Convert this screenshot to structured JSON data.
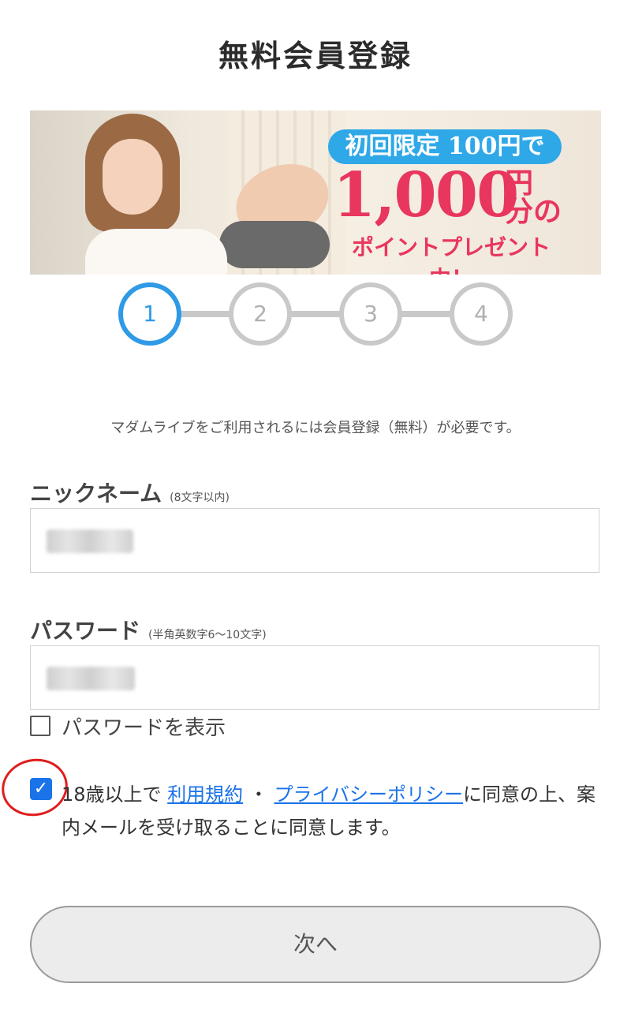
{
  "page": {
    "title": "無料会員登録"
  },
  "banner": {
    "pill_text": "初回限定 100円で",
    "amount": "1,000",
    "unit_line1": "円",
    "unit_line2": "分の",
    "promo_text": "ポイントプレゼント中！"
  },
  "steps": {
    "items": [
      "1",
      "2",
      "3",
      "4"
    ],
    "active": 1
  },
  "intro": "マダムライブをご利用されるには会員登録（無料）が必要です。",
  "nickname": {
    "label": "ニックネーム",
    "hint": "(8文字以内)"
  },
  "password": {
    "label": "パスワード",
    "hint": "(半角英数字6〜10文字)"
  },
  "show_password": {
    "label": "パスワードを表示",
    "checked": false
  },
  "agreement": {
    "checked": true,
    "prefix": "18歳以上で",
    "terms_link": "利用規約",
    "separator": "・",
    "privacy_link": "プライバシーポリシー",
    "suffix": "に同意の上、案内メールを受け取ることに同意します。"
  },
  "next_button": {
    "label": "次へ"
  },
  "colors": {
    "accent": "#2f9ae5",
    "promo": "#e8365e",
    "link": "#1a73e8",
    "annotation": "#e01c1c"
  }
}
